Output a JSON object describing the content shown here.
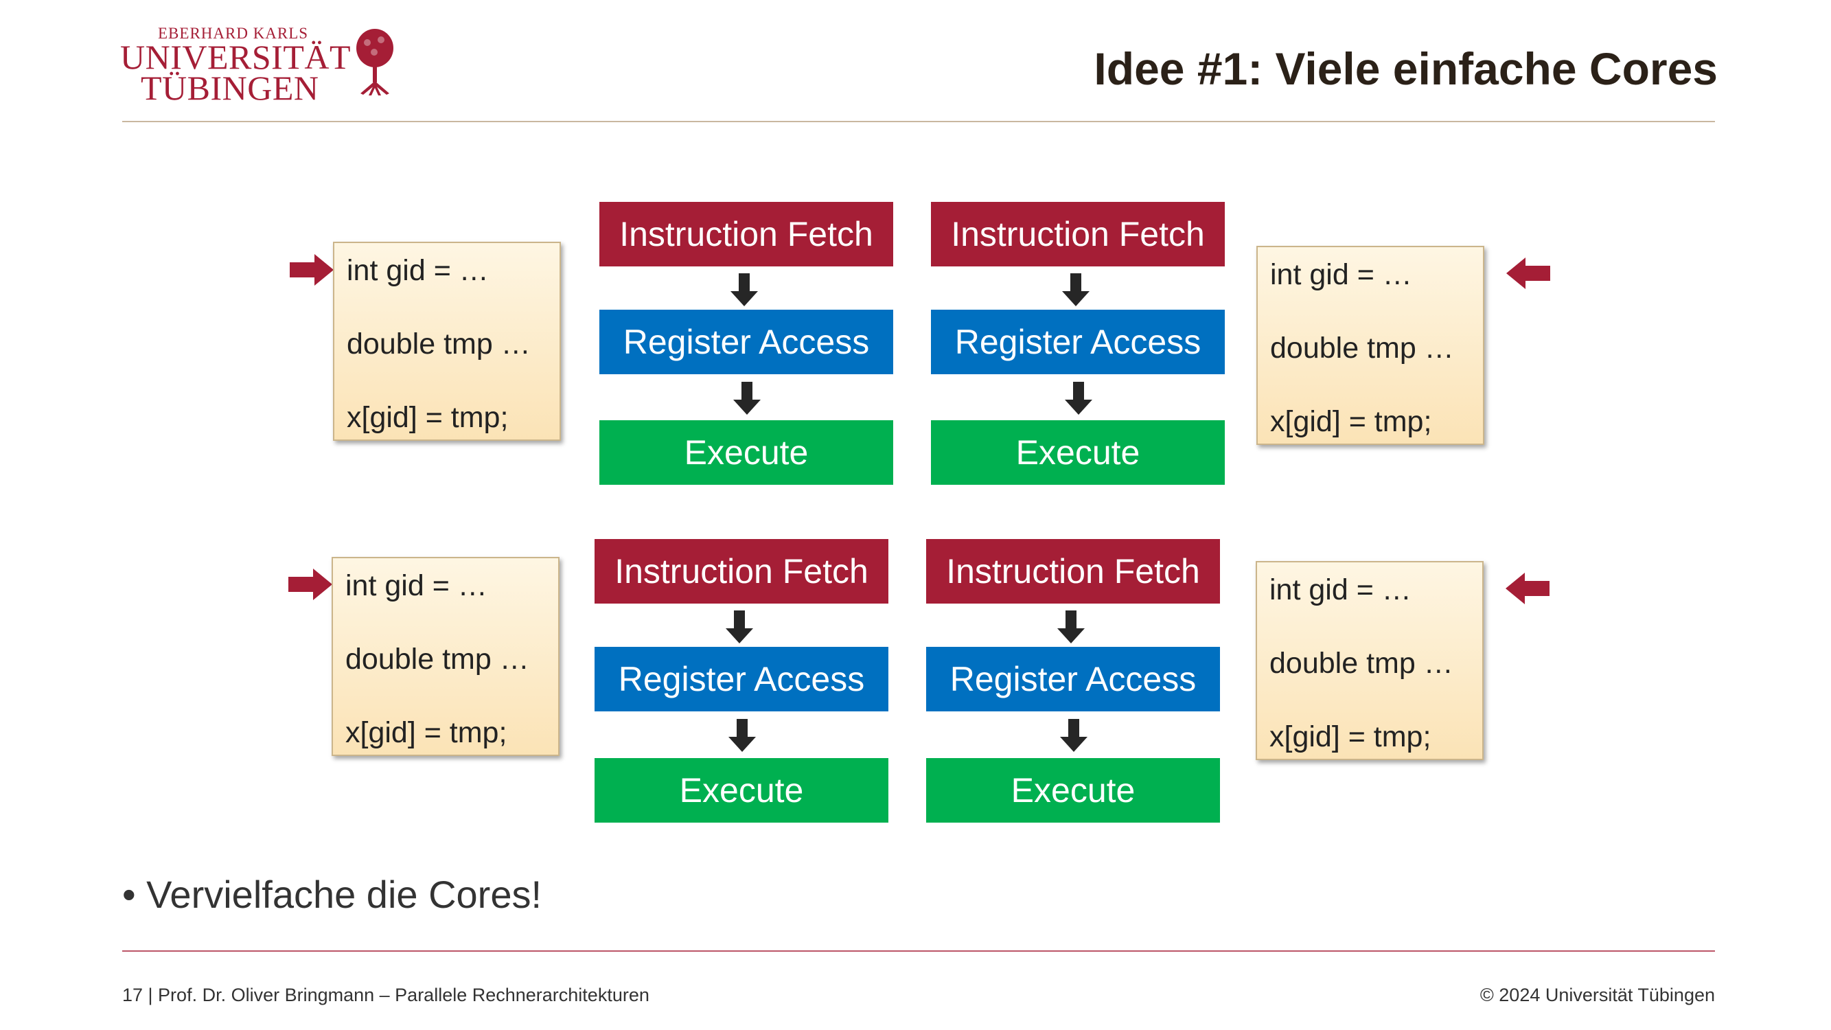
{
  "header": {
    "logo_line1": "EBERHARD KARLS",
    "logo_line2": "UNIVERSITÄT",
    "logo_line3": "TÜBINGEN",
    "title": "Idee #1: Viele einfache Cores"
  },
  "code_boxes": [
    {
      "line1": "int gid = …",
      "line2": "double tmp  …",
      "line3": "x[gid] = tmp;"
    },
    {
      "line1": "int gid = …",
      "line2": "double tmp  …",
      "line3": "x[gid] = tmp;"
    },
    {
      "line1": "int gid = …",
      "line2": "double tmp …",
      "line3": "x[gid] = tmp;"
    },
    {
      "line1": "int gid = …",
      "line2": "double tmp …",
      "line3": "x[gid] = tmp;"
    }
  ],
  "cores": [
    {
      "fetch": "Instruction Fetch",
      "register": "Register Access",
      "execute": "Execute"
    },
    {
      "fetch": "Instruction Fetch",
      "register": "Register Access",
      "execute": "Execute"
    },
    {
      "fetch": "Instruction Fetch",
      "register": "Register Access",
      "execute": "Execute"
    },
    {
      "fetch": "Instruction Fetch",
      "register": "Register Access",
      "execute": "Execute"
    }
  ],
  "bullet": "Vervielfache die Cores!",
  "footer": {
    "left": "17 | Prof. Dr. Oliver Bringmann – Parallele Rechnerarchitekturen",
    "right": "© 2024 Universität Tübingen"
  },
  "colors": {
    "fetch": "#a51e36",
    "register": "#0070c0",
    "execute": "#00b050",
    "pointer_arrow": "#a51e36"
  }
}
